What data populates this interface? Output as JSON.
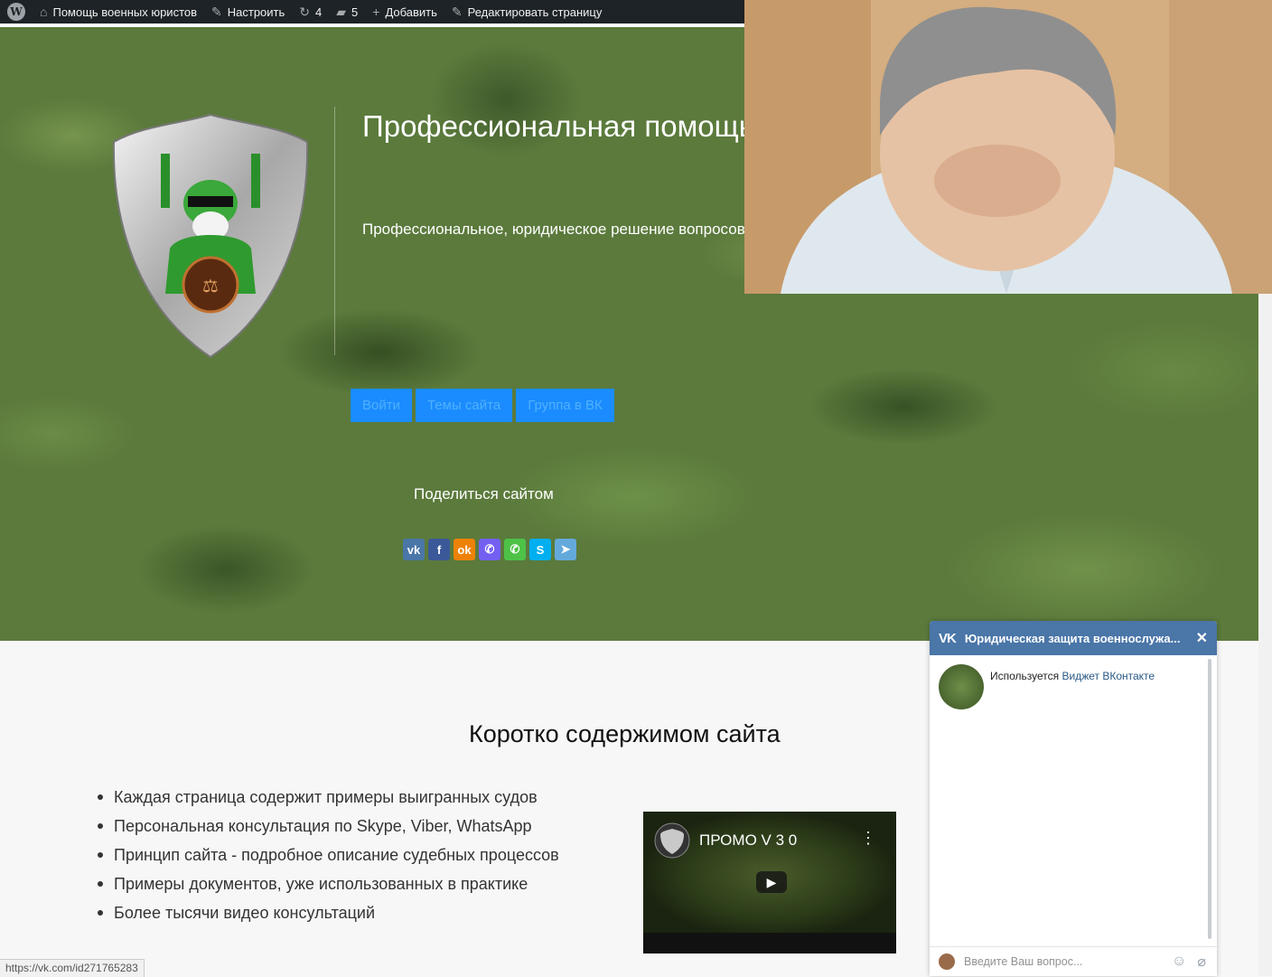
{
  "adminbar": {
    "site_name": "Помощь военных юристов",
    "customize": "Настроить",
    "updates_count": "4",
    "comments_count": "5",
    "add_new": "Добавить",
    "edit_page": "Редактировать страницу"
  },
  "hero": {
    "title": "Профессиональная помощь военных юристов",
    "subtitle": "Профессиональное, юридическое решение вопросов в военной сфере",
    "buttons": [
      "Войти",
      "Темы сайта",
      "Группа в ВК"
    ],
    "share_label": "Поделиться сайтом",
    "share_icons": [
      {
        "name": "vk-icon",
        "glyph": "vk",
        "color": "#4a76a8"
      },
      {
        "name": "facebook-icon",
        "glyph": "f",
        "color": "#3b5998"
      },
      {
        "name": "odnoklassniki-icon",
        "glyph": "ok",
        "color": "#ee8208"
      },
      {
        "name": "viber-icon",
        "glyph": "✆",
        "color": "#7360f2"
      },
      {
        "name": "whatsapp-icon",
        "glyph": "✆",
        "color": "#4dc247"
      },
      {
        "name": "skype-icon",
        "glyph": "S",
        "color": "#00aff0"
      },
      {
        "name": "telegram-icon",
        "glyph": "➤",
        "color": "#64a9dc"
      }
    ]
  },
  "content": {
    "title": "Коротко содержимом сайта",
    "features": [
      "Каждая страница содержит примеры выигранных судов",
      "Персональная консультация по Skype, Viber, WhatsApp",
      "Принцип сайта - подробное описание судебных процессов",
      "Примеры документов, уже использованных в практике",
      "Более тысячи видео консультаций"
    ]
  },
  "video": {
    "title": "ПРОМО V 3 0"
  },
  "status_url": "https://vk.com/id271765283",
  "vk_widget": {
    "title": "Юридическая защита военнослужа...",
    "message_prefix": "Используется",
    "message_link": "Виджет ВКонтакте",
    "input_placeholder": "Введите Ваш вопрос..."
  },
  "colors": {
    "accent_button": "#1a8cff",
    "vk_header": "#4a76a8",
    "adminbar": "#1d2327"
  }
}
